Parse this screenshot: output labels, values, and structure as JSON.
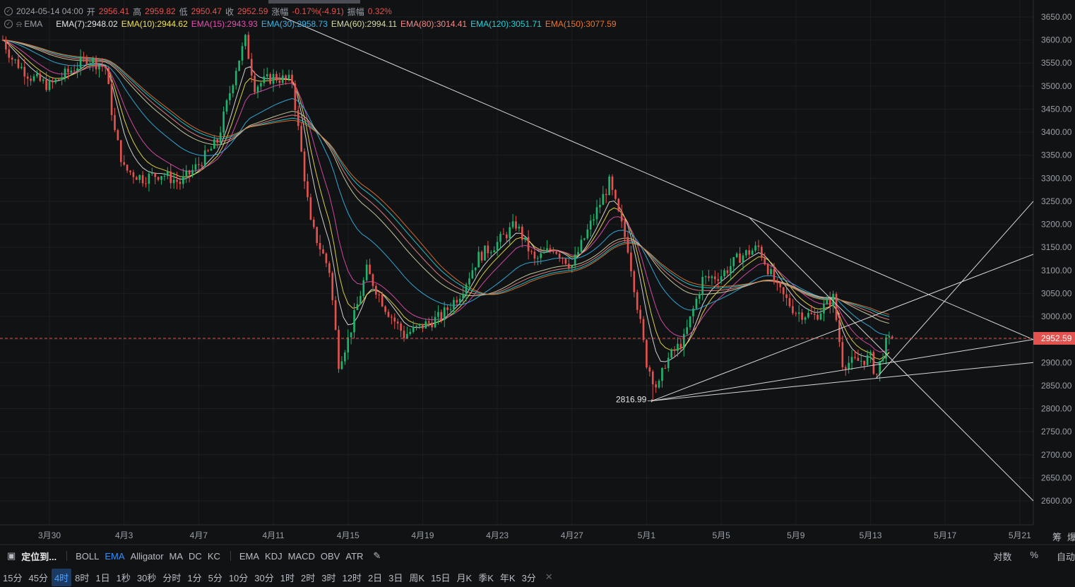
{
  "header": {
    "datetime": "2024-05-14 04:00",
    "open_label": "开",
    "open": "2956.41",
    "high_label": "高",
    "high": "2959.82",
    "low_label": "低",
    "low": "2950.47",
    "close_label": "收",
    "close": "2952.59",
    "change_label": "涨幅",
    "change": "-0.17%(-4.91)",
    "amp_label": "振幅",
    "amp": "0.32%",
    "indicator_name": "EMA"
  },
  "ema_legend": [
    {
      "label": "EMA(7):2948.02",
      "color": "#e6e6e6"
    },
    {
      "label": "EMA(10):2944.62",
      "color": "#f3e34a"
    },
    {
      "label": "EMA(15):2943.93",
      "color": "#e44fb0"
    },
    {
      "label": "EMA(30):2958.73",
      "color": "#33b6e8"
    },
    {
      "label": "EMA(60):2994.11",
      "color": "#d6d9a6"
    },
    {
      "label": "EMA(80):3014.41",
      "color": "#f08a8a"
    },
    {
      "label": "EMA(120):3051.71",
      "color": "#21d3dc"
    },
    {
      "label": "EMA(150):3077.59",
      "color": "#e8762d"
    }
  ],
  "chart_data": {
    "type": "candlestick",
    "ylim": [
      2580,
      3670
    ],
    "y_ticks": [
      "3650.00",
      "3600.00",
      "3550.00",
      "3500.00",
      "3450.00",
      "3400.00",
      "3350.00",
      "3300.00",
      "3250.00",
      "3200.00",
      "3150.00",
      "3100.00",
      "3050.00",
      "3000.00",
      "2950.00",
      "2900.00",
      "2850.00",
      "2800.00",
      "2750.00",
      "2700.00",
      "2650.00",
      "2600.00"
    ],
    "x_ticks": [
      {
        "label": "3月30",
        "day": 0
      },
      {
        "label": "4月3",
        "day": 4
      },
      {
        "label": "4月7",
        "day": 8
      },
      {
        "label": "4月11",
        "day": 12
      },
      {
        "label": "4月15",
        "day": 16
      },
      {
        "label": "4月19",
        "day": 20
      },
      {
        "label": "4月23",
        "day": 24
      },
      {
        "label": "4月27",
        "day": 28
      },
      {
        "label": "5月1",
        "day": 32
      },
      {
        "label": "5月5",
        "day": 36
      },
      {
        "label": "5月9",
        "day": 40
      },
      {
        "label": "5月13",
        "day": 44
      },
      {
        "label": "5月17",
        "day": 48
      },
      {
        "label": "5月21",
        "day": 52
      }
    ],
    "close_path": [
      [
        -2.5,
        3600
      ],
      [
        -2,
        3560
      ],
      [
        -1,
        3520
      ],
      [
        0,
        3500
      ],
      [
        1,
        3530
      ],
      [
        2,
        3560
      ],
      [
        3,
        3540
      ],
      [
        3.5,
        3400
      ],
      [
        4,
        3320
      ],
      [
        5,
        3300
      ],
      [
        6,
        3310
      ],
      [
        7,
        3290
      ],
      [
        8,
        3330
      ],
      [
        9,
        3380
      ],
      [
        10,
        3540
      ],
      [
        10.5,
        3600
      ],
      [
        11,
        3500
      ],
      [
        12,
        3520
      ],
      [
        13,
        3510
      ],
      [
        14,
        3200
      ],
      [
        15,
        3100
      ],
      [
        15.5,
        2900
      ],
      [
        16,
        2950
      ],
      [
        17,
        3100
      ],
      [
        18,
        3020
      ],
      [
        19,
        2960
      ],
      [
        20,
        2980
      ],
      [
        21,
        3000
      ],
      [
        22,
        3050
      ],
      [
        23,
        3130
      ],
      [
        24,
        3160
      ],
      [
        25,
        3200
      ],
      [
        26,
        3120
      ],
      [
        27,
        3150
      ],
      [
        28,
        3110
      ],
      [
        29,
        3200
      ],
      [
        30,
        3290
      ],
      [
        31,
        3150
      ],
      [
        32,
        2900
      ],
      [
        32.6,
        2840
      ],
      [
        33,
        2900
      ],
      [
        34,
        2950
      ],
      [
        35,
        3080
      ],
      [
        36,
        3090
      ],
      [
        37,
        3130
      ],
      [
        38,
        3150
      ],
      [
        39,
        3060
      ],
      [
        40,
        3010
      ],
      [
        41,
        3000
      ],
      [
        42,
        3040
      ],
      [
        42.5,
        2900
      ],
      [
        43,
        2900
      ],
      [
        44,
        2910
      ],
      [
        44.3,
        2870
      ],
      [
        44.8,
        2940
      ],
      [
        45.2,
        2952.59
      ]
    ],
    "ema_lag": [
      0.6,
      0.9,
      1.4,
      3.0,
      5.5,
      7.0,
      9.0,
      11.0
    ],
    "last_close": "2952.59",
    "low_annotation": "2816.99",
    "low_point": {
      "day": 32.3,
      "price": 2816.99
    }
  },
  "toolbar": {
    "locate": "定位到...",
    "indicators": [
      "BOLL",
      "EMA",
      "Alligator",
      "MA",
      "DC",
      "KC"
    ],
    "active_indicator": "EMA",
    "sub_indicators": [
      "EMA",
      "KDJ",
      "MACD",
      "OBV",
      "ATR"
    ],
    "right": [
      "对数",
      "%",
      "自动"
    ]
  },
  "timeframes": [
    "15分",
    "45分",
    "4时",
    "8时",
    "1日",
    "1秒",
    "30秒",
    "分时",
    "1分",
    "5分",
    "10分",
    "30分",
    "1时",
    "2时",
    "3时",
    "12时",
    "2日",
    "3日",
    "周K",
    "15日",
    "月K",
    "季K",
    "年K",
    "3分"
  ],
  "active_timeframe": "4时",
  "side_labels": [
    "筹",
    "爆"
  ]
}
